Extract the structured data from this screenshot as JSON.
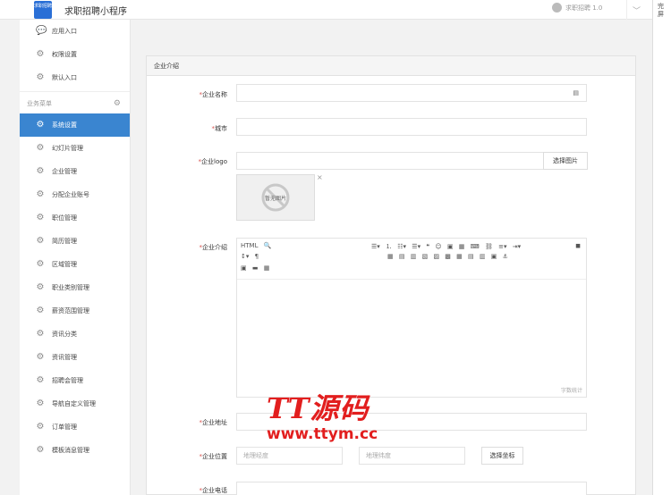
{
  "header": {
    "logo_text": "求职招聘",
    "title": "求职招聘小程序",
    "version_label": "求职招聘 1.0",
    "chevron": "chevron-down-icon"
  },
  "right_strip": {
    "text": "完屏"
  },
  "sidebar": {
    "top_items": [
      {
        "label": "应用入口",
        "icon": "chat-icon"
      },
      {
        "label": "权限设置",
        "icon": "gear-icon"
      },
      {
        "label": "默认入口",
        "icon": "gear-icon"
      }
    ],
    "group_label": "业务菜单",
    "items": [
      {
        "label": "系统设置",
        "active": true
      },
      {
        "label": "幻灯片管理"
      },
      {
        "label": "企业管理"
      },
      {
        "label": "分配企业账号"
      },
      {
        "label": "职位管理"
      },
      {
        "label": "简历管理"
      },
      {
        "label": "区域管理"
      },
      {
        "label": "职业类别管理"
      },
      {
        "label": "薪资范围管理"
      },
      {
        "label": "资讯分类"
      },
      {
        "label": "资讯管理"
      },
      {
        "label": "招聘会管理"
      },
      {
        "label": "导航自定义管理"
      },
      {
        "label": "订单管理"
      },
      {
        "label": "模板消息管理"
      }
    ]
  },
  "panel": {
    "title": "企业介绍",
    "fields": {
      "name_label": "企业名称",
      "city_label": "城市",
      "logo_label": "企业logo",
      "logo_button": "选择图片",
      "logo_placeholder": "暂无图片",
      "intro_label": "企业介绍",
      "word_count": "字数统计",
      "address_label": "企业地址",
      "position_label": "企业位置",
      "lat_placeholder": "地理经度",
      "lng_placeholder": "地理纬度",
      "coord_button": "选择坐标",
      "phone_label": "企业电话"
    }
  },
  "watermark": {
    "brand": "TT源码",
    "url": "www.ttym.cc"
  },
  "colors": {
    "accent": "#3a85d0",
    "required": "#d9534f",
    "watermark": "#e21e1e"
  }
}
